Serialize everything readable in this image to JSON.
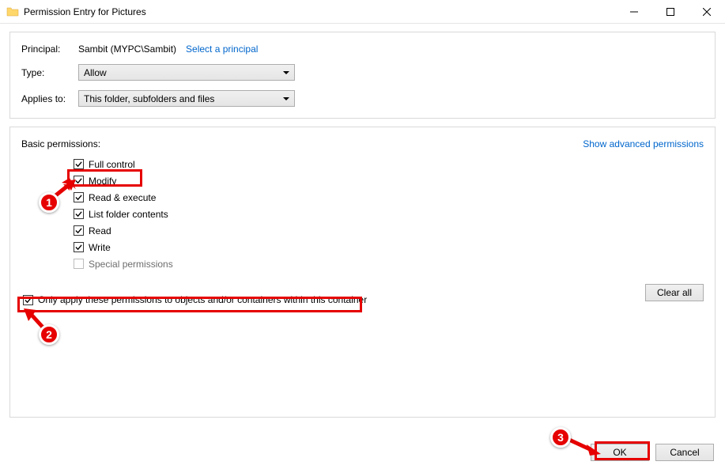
{
  "window": {
    "title": "Permission Entry for Pictures"
  },
  "labels": {
    "principal": "Principal:",
    "type": "Type:",
    "applies_to": "Applies to:"
  },
  "principal": {
    "value": "Sambit (MYPC\\Sambit)",
    "select_link": "Select a principal"
  },
  "type_select": "Allow",
  "applies_select": "This folder, subfolders and files",
  "permissions": {
    "title": "Basic permissions:",
    "advanced_link": "Show advanced permissions",
    "items": [
      {
        "label": "Full control",
        "checked": true
      },
      {
        "label": "Modify",
        "checked": true
      },
      {
        "label": "Read & execute",
        "checked": true
      },
      {
        "label": "List folder contents",
        "checked": true
      },
      {
        "label": "Read",
        "checked": true
      },
      {
        "label": "Write",
        "checked": true
      },
      {
        "label": "Special permissions",
        "checked": false,
        "disabled": true
      }
    ],
    "only_apply": {
      "label": "Only apply these permissions to objects and/or containers within this container",
      "checked": true
    },
    "clear_all": "Clear all"
  },
  "buttons": {
    "ok": "OK",
    "cancel": "Cancel"
  },
  "annotations": {
    "badge1": "1",
    "badge2": "2",
    "badge3": "3"
  }
}
